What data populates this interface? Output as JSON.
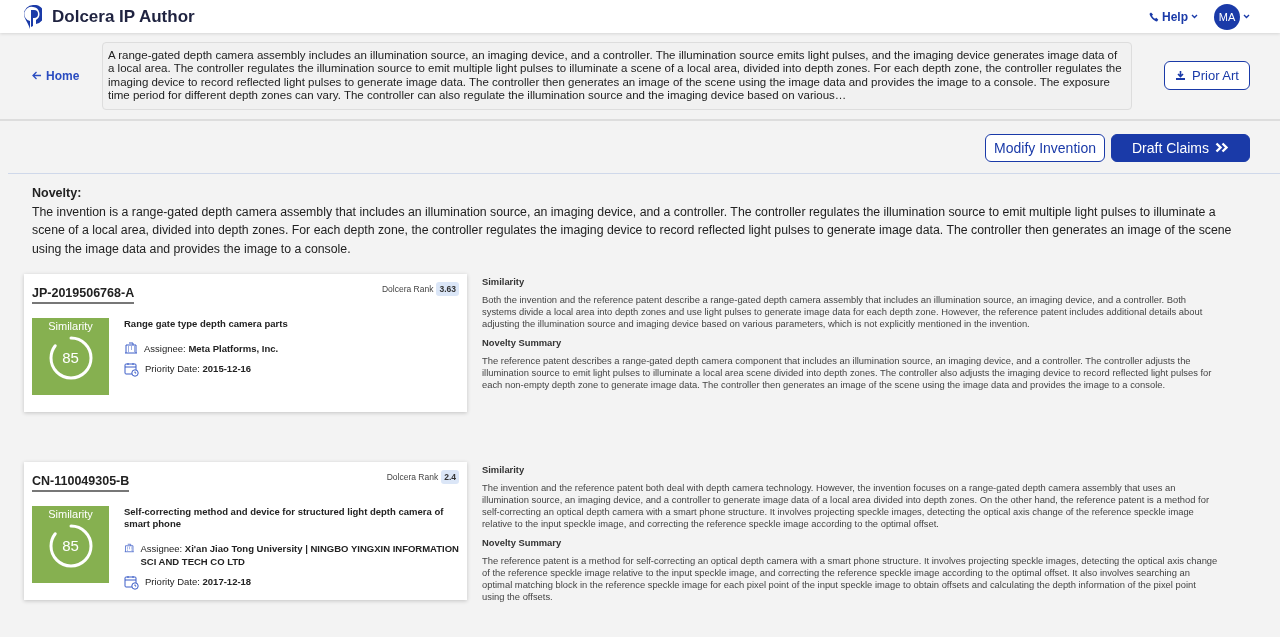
{
  "header": {
    "app_title": "Dolcera IP Author",
    "help": "Help",
    "avatar": "MA"
  },
  "top": {
    "home": "Home",
    "abstract": "A range-gated depth camera assembly includes an illumination source, an imaging device, and a controller. The illumination source emits light pulses, and the imaging device generates image data of a local area. The controller regulates the illumination source to emit multiple light pulses to illuminate a scene of a local area, divided into depth zones. For each depth zone, the controller regulates the imaging device to record reflected light pulses to generate image data. The controller then generates an image of the scene using the image data and provides the image to a console. The exposure time period for different depth zones can vary. The controller can also regulate the illumination source and the imaging device based on various…",
    "prior_art": "Prior Art"
  },
  "actions": {
    "modify": "Modify Invention",
    "draft": "Draft Claims"
  },
  "novelty": {
    "heading": "Novelty:",
    "text": "The invention is a range-gated depth camera assembly that includes an illumination source, an imaging device, and a controller. The controller regulates the illumination source to emit multiple light pulses to illuminate a scene of a local area, divided into depth zones. For each depth zone, the controller regulates the imaging device to record reflected light pulses to generate image data. The controller then generates an image of the scene using the image data and provides the image to a console."
  },
  "results": [
    {
      "number": "JP-2019506768-A",
      "rank_label": "Dolcera Rank",
      "rank": "3.63",
      "similarity_label": "Similarity",
      "similarity": "85",
      "title": "Range gate type depth camera parts",
      "assignee_label": "Assignee:",
      "assignee": "Meta Platforms, Inc.",
      "date_label": "Priority Date:",
      "date": "2015-12-16",
      "similarity_heading": "Similarity",
      "similarity_text": "Both the invention and the reference patent describe a range-gated depth camera assembly that includes an illumination source, an imaging device, and a controller. Both systems divide a local area into depth zones and use light pulses to generate image data for each depth zone. However, the reference patent includes additional details about adjusting the illumination source and imaging device based on various parameters, which is not explicitly mentioned in the invention.",
      "summary_heading": "Novelty Summary",
      "summary_text": "The reference patent describes a range-gated depth camera component that includes an illumination source, an imaging device, and a controller. The controller adjusts the illumination source to emit light pulses to illuminate a local area scene divided into depth zones. The controller also adjusts the imaging device to record reflected light pulses for each non-empty depth zone to generate image data. The controller then generates an image of the scene using the image data and provides the image to a console."
    },
    {
      "number": "CN-110049305-B",
      "rank_label": "Dolcera Rank",
      "rank": "2.4",
      "similarity_label": "Similarity",
      "similarity": "85",
      "title": "Self-correcting method and device for structured light depth camera of smart phone",
      "assignee_label": "Assignee:",
      "assignee": "Xi'an Jiao Tong University | NINGBO YINGXIN INFORMATION SCI AND TECH CO LTD",
      "date_label": "Priority Date:",
      "date": "2017-12-18",
      "similarity_heading": "Similarity",
      "similarity_text": "The invention and the reference patent both deal with depth camera technology. However, the invention focuses on a range-gated depth camera assembly that uses an illumination source, an imaging device, and a controller to generate image data of a local area divided into depth zones. On the other hand, the reference patent is a method for self-correcting an optical depth camera with a smart phone structure. It involves projecting speckle images, detecting the optical axis change of the reference speckle image relative to the input speckle image, and correcting the reference speckle image according to the optimal offset.",
      "summary_heading": "Novelty Summary",
      "summary_text": "The reference patent is a method for self-correcting an optical depth camera with a smart phone structure. It involves projecting speckle images, detecting the optical axis change of the reference speckle image relative to the input speckle image, and correcting the reference speckle image according to the optimal offset. It also involves searching an optimal matching block in the reference speckle image for each pixel point of the input speckle image to obtain offsets and calculating the depth information of the pixel point using the offsets."
    }
  ]
}
